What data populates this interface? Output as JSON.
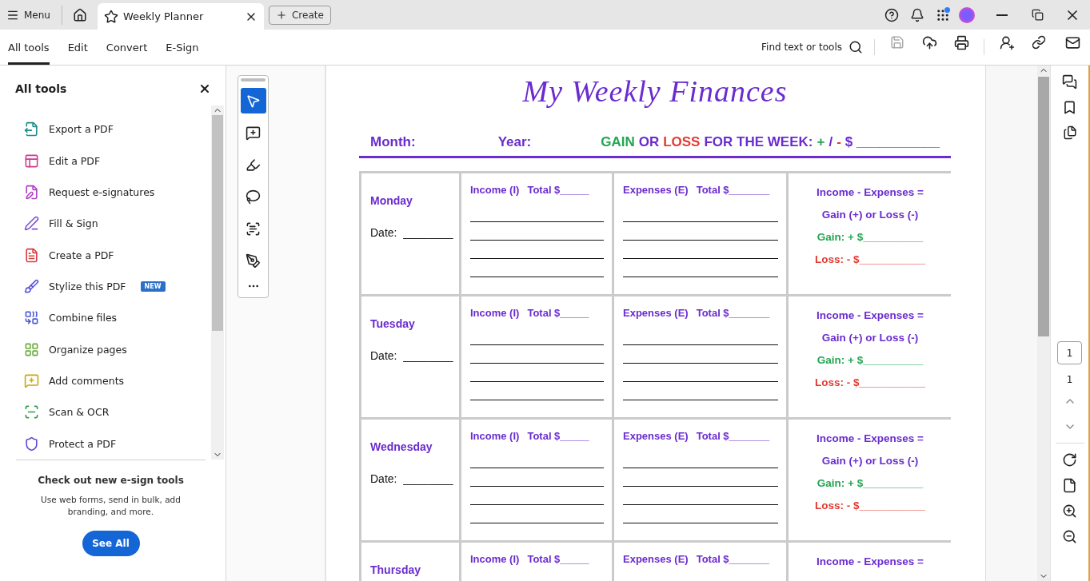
{
  "app": {
    "menu": "Menu",
    "tab": {
      "title": "Weekly Planner"
    },
    "create": "Create"
  },
  "toolbar": {
    "tabs": [
      {
        "label": "All tools",
        "selected": true
      },
      {
        "label": "Edit",
        "selected": false
      },
      {
        "label": "Convert",
        "selected": false
      },
      {
        "label": "E-Sign",
        "selected": false
      }
    ],
    "find": "Find text or tools"
  },
  "tools_panel": {
    "title": "All tools",
    "items": [
      {
        "label": "Export a PDF",
        "color": "#1a8c8c"
      },
      {
        "label": "Edit a PDF",
        "color": "#d03a8c"
      },
      {
        "label": "Request e-signatures",
        "color": "#b23ac8"
      },
      {
        "label": "Fill & Sign",
        "color": "#7b4fd0"
      },
      {
        "label": "Create a PDF",
        "color": "#d83c3c"
      },
      {
        "label": "Stylize this PDF",
        "badge": "NEW",
        "color": "#5a56d6"
      },
      {
        "label": "Combine files",
        "color": "#4a5ad8"
      },
      {
        "label": "Organize pages",
        "color": "#6aaa3a"
      },
      {
        "label": "Add comments",
        "color": "#c8a812"
      },
      {
        "label": "Scan & OCR",
        "color": "#2e9a4a"
      },
      {
        "label": "Protect a PDF",
        "color": "#5a4ad0"
      }
    ],
    "promo": {
      "title": "Check out new e-sign tools",
      "text": "Use web forms, send in bulk, add branding, and more.",
      "button": "See All"
    }
  },
  "annotation_tools": [
    {
      "selected": true
    },
    {
      "selected": false
    },
    {
      "selected": false
    },
    {
      "selected": false
    },
    {
      "selected": false
    },
    {
      "selected": false
    }
  ],
  "document": {
    "title": "My Weekly Finances",
    "month": "Month:",
    "year": "Year:",
    "summary": [
      {
        "text": "GAIN",
        "color": "#22a650"
      },
      {
        "text": "OR",
        "color": "#6a2ccf"
      },
      {
        "text": "LOSS",
        "color": "#e23a32"
      },
      {
        "text": "FOR THE WEEK:",
        "color": "#6a2ccf"
      },
      {
        "text": "+",
        "color": "#22a650"
      },
      {
        "text": "/",
        "color": "#6a2ccf"
      },
      {
        "text": "-",
        "color": "#e23a32"
      },
      {
        "text": "$ ___________",
        "color": "#6a2ccf"
      }
    ],
    "days": [
      {
        "day": "Monday",
        "date_label": "Date:",
        "date_line": "________",
        "income": "Income (I)",
        "income_total": "Total $_____",
        "expenses": "Expenses (E)",
        "expenses_total": "Total $_______",
        "result": [
          {
            "text": "Income - Expenses =",
            "color": "#6a2ccf"
          },
          {
            "text": "Gain (+) or Loss (-)",
            "color": "#6a2ccf"
          },
          {
            "text": "Gain: + $__________",
            "color": "#22a650"
          },
          {
            "text": "Loss: - $___________",
            "color": "#e23a32"
          }
        ]
      },
      {
        "day": "Tuesday",
        "date_label": "Date:",
        "date_line": "________",
        "income": "Income (I)",
        "income_total": "Total $_____",
        "expenses": "Expenses (E)",
        "expenses_total": "Total $_______",
        "result": [
          {
            "text": "Income - Expenses =",
            "color": "#6a2ccf"
          },
          {
            "text": "Gain (+) or Loss (-)",
            "color": "#6a2ccf"
          },
          {
            "text": "Gain: + $__________",
            "color": "#22a650"
          },
          {
            "text": "Loss: - $___________",
            "color": "#e23a32"
          }
        ]
      },
      {
        "day": "Wednesday",
        "date_label": "Date:",
        "date_line": "________",
        "income": "Income (I)",
        "income_total": "Total $_____",
        "expenses": "Expenses (E)",
        "expenses_total": "Total $_______",
        "result": [
          {
            "text": "Income - Expenses =",
            "color": "#6a2ccf"
          },
          {
            "text": "Gain (+) or Loss (-)",
            "color": "#6a2ccf"
          },
          {
            "text": "Gain: + $__________",
            "color": "#22a650"
          },
          {
            "text": "Loss: - $___________",
            "color": "#e23a32"
          }
        ]
      },
      {
        "day": "Thursday",
        "income": "Income (I)",
        "income_total": "Total $_____",
        "expenses": "Expenses (E)",
        "expenses_total": "Total $_______",
        "result": [
          {
            "text": "Income - Expenses =",
            "color": "#6a2ccf"
          }
        ]
      }
    ]
  },
  "page_nav": {
    "current": "1",
    "total": "1"
  }
}
